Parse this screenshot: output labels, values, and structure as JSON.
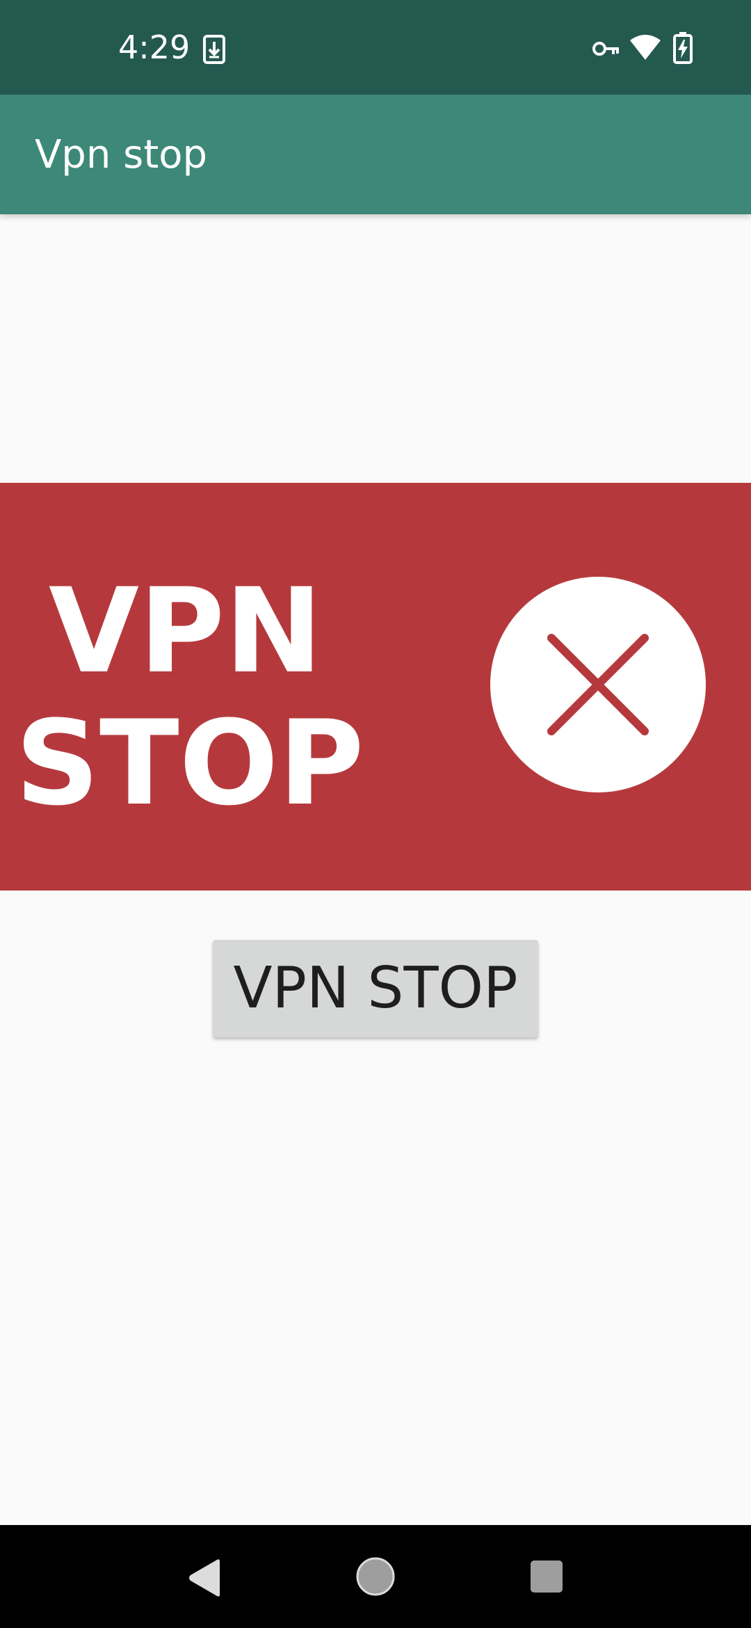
{
  "status_bar": {
    "time": "4:29",
    "icons": [
      "download-notification-icon",
      "vpn-key-icon",
      "wifi-icon",
      "battery-charging-icon"
    ]
  },
  "app_bar": {
    "title": "Vpn stop"
  },
  "banner": {
    "line1": "VPN",
    "line2": "STOP",
    "icon": "close-icon",
    "background_color": "#b5393c"
  },
  "main": {
    "button_label": "VPN STOP"
  },
  "nav_bar": {
    "buttons": [
      "back-icon",
      "home-icon",
      "recents-icon"
    ]
  },
  "colors": {
    "status_bar": "#245950",
    "app_bar": "#3d8878",
    "accent_red": "#b5393c",
    "button_bg": "#d6d7d7"
  }
}
